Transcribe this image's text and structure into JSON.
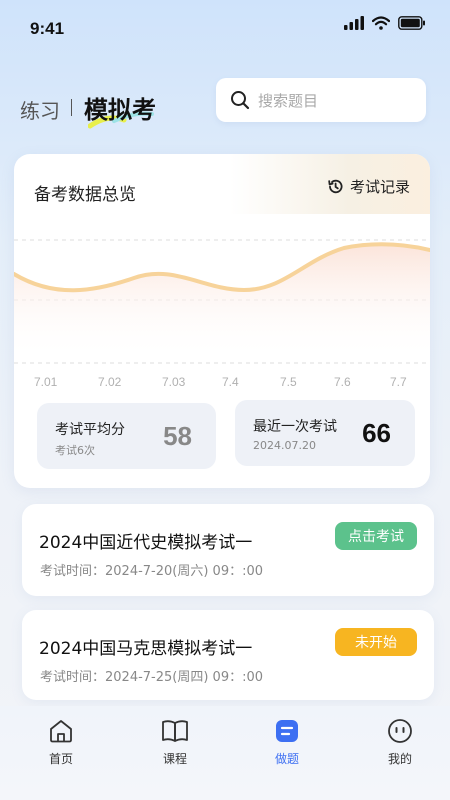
{
  "status_bar": {
    "time": "9:41",
    "icons": [
      "signal-icon",
      "wifi-icon",
      "battery-icon"
    ]
  },
  "header": {
    "tab_practice": "练习",
    "tab_exam": "模拟考",
    "search_placeholder": "搜索题目"
  },
  "overview": {
    "title": "备考数据总览",
    "history_label": "考试记录",
    "chart_dates": [
      "7.01",
      "7.02",
      "7.03",
      "7.4",
      "7.5",
      "7.6",
      "7.7"
    ]
  },
  "stats": {
    "avg_label": "考试平均分",
    "avg_sub": "考试6次",
    "avg_value": "58",
    "last_label": "最近一次考试",
    "last_sub": "2024.07.20",
    "last_value": "66"
  },
  "exams": [
    {
      "title": "2024中国近代史模拟考试一",
      "time": "考试时间：2024-7-20(周六)  09：:00",
      "button": "点击考试"
    },
    {
      "title": "2024中国马克思模拟考试一",
      "time": "考试时间：2024-7-25(周四)  09：:00",
      "button": "未开始"
    }
  ],
  "tabbar": {
    "home": "首页",
    "course": "课程",
    "quiz": "做题",
    "mine": "我的"
  },
  "colors": {
    "accent": "#3d6ff2",
    "green": "#5cc28c",
    "orange": "#f7b521",
    "curve": "#f7d39a"
  }
}
